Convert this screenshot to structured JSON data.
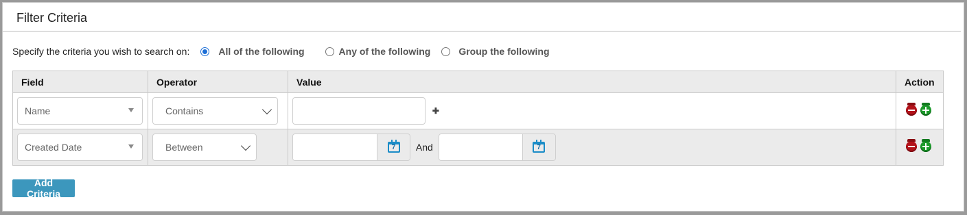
{
  "panel": {
    "title": "Filter Criteria"
  },
  "criteria": {
    "prompt": "Specify the criteria you wish to search on:",
    "options": [
      {
        "label": "All of the following",
        "checked": true
      },
      {
        "label": "Any of the following",
        "checked": false
      },
      {
        "label": "Group the following",
        "checked": false
      }
    ]
  },
  "table": {
    "headers": {
      "field": "Field",
      "operator": "Operator",
      "value": "Value",
      "action": "Action"
    },
    "rows": [
      {
        "field": "Name",
        "operator": "Contains",
        "value": ""
      },
      {
        "field": "Created Date",
        "operator": "Between",
        "value_from": "",
        "and_label": "And",
        "value_to": ""
      }
    ]
  },
  "buttons": {
    "add_criteria": "Add Criteria"
  },
  "icons": {
    "calendar_day": "7",
    "remove": "remove-icon",
    "add": "add-icon",
    "plus": "✚"
  },
  "colors": {
    "accent_button": "#3c97bd",
    "radio_checked": "#1d6fd6",
    "remove_icon": "#b3121a",
    "add_icon": "#1c9a2b",
    "calendar": "#1a8cc7"
  }
}
